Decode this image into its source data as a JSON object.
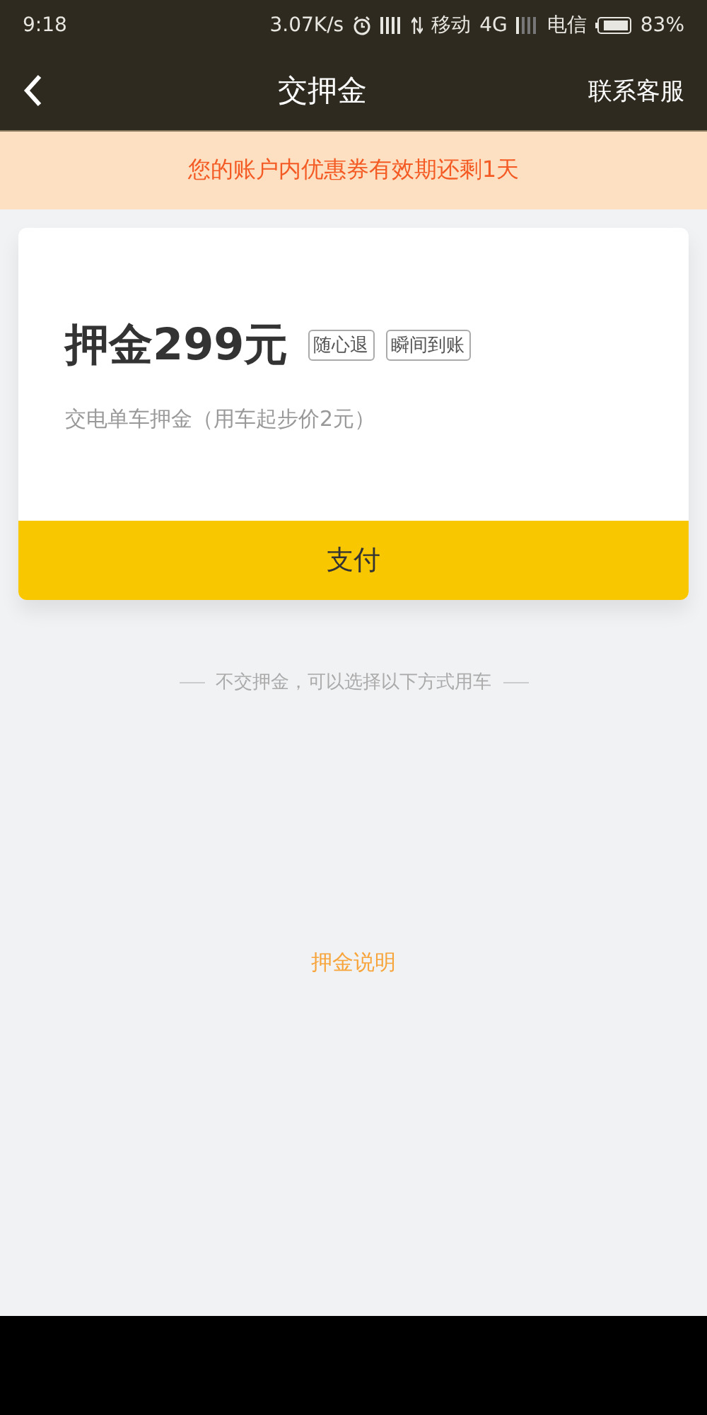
{
  "status_bar": {
    "time": "9:18",
    "speed": "3.07K/s",
    "carrier_1": "移动",
    "network": "4G",
    "carrier_2": "电信",
    "battery": "83%"
  },
  "header": {
    "title": "交押金",
    "action": "联系客服"
  },
  "notice": "您的账户内优惠券有效期还剩1天",
  "deposit_card": {
    "amount": "押金299元",
    "tags": [
      "随心退",
      "瞬间到账"
    ],
    "description": "交电单车押金（用车起步价2元）",
    "pay_button": "支付"
  },
  "divider_text": "不交押金，可以选择以下方式用车",
  "info_link": "押金说明"
}
